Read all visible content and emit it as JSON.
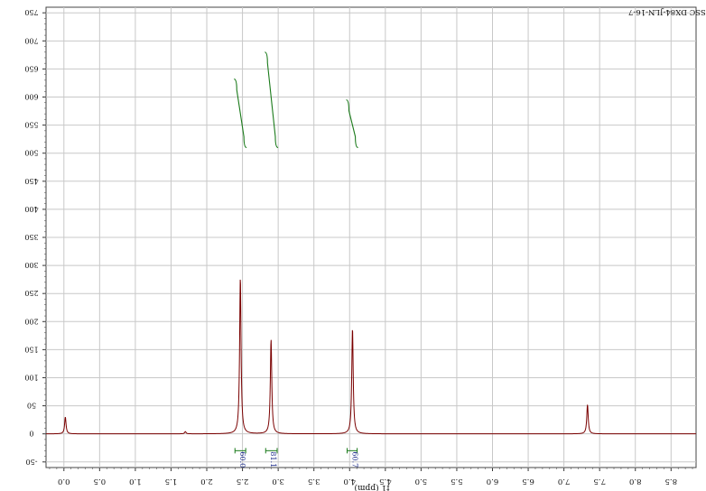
{
  "title": "SSC DX84-JLN-16-7",
  "chart_data": {
    "type": "line",
    "title": "SSC DX84-JLN-16-7",
    "xlabel": "f1 (ppm)",
    "ylabel": "",
    "x_reversed_display": true,
    "xlim": [
      -0.25,
      8.85
    ],
    "ylim": [
      -60,
      760
    ],
    "x_ticks": [
      "0.0",
      "0.5",
      "1.0",
      "1.5",
      "2.0",
      "2.5",
      "3.0",
      "3.5",
      "4.0",
      "4.5",
      "5.0",
      "5.5",
      "6.0",
      "6.5",
      "7.0",
      "7.5",
      "8.0",
      "8.5"
    ],
    "x_tick_values": [
      0.0,
      0.5,
      1.0,
      1.5,
      2.0,
      2.5,
      3.0,
      3.5,
      4.0,
      4.5,
      5.0,
      5.5,
      6.0,
      6.5,
      7.0,
      7.5,
      8.0,
      8.5
    ],
    "y_ticks": [
      "750",
      "700",
      "650",
      "600",
      "550",
      "500",
      "450",
      "400",
      "350",
      "300",
      "250",
      "200",
      "150",
      "100",
      "50",
      "0",
      "-50"
    ],
    "y_tick_values": [
      750,
      700,
      650,
      600,
      550,
      500,
      450,
      400,
      350,
      300,
      250,
      200,
      150,
      100,
      50,
      0,
      -50
    ],
    "grid": true,
    "line_color": "#7a0000",
    "integral_color": "#1a7a1a",
    "integral_label_color": "#1a2a8a",
    "peaks": [
      {
        "x": 0.02,
        "height": 30
      },
      {
        "x": 1.7,
        "height": 4
      },
      {
        "x": 2.47,
        "height": 278
      },
      {
        "x": 2.9,
        "height": 168
      },
      {
        "x": 4.04,
        "height": 188
      },
      {
        "x": 7.33,
        "height": 52
      }
    ],
    "integrals": [
      {
        "x": 2.47,
        "from": 2.42,
        "to": 2.52,
        "label": "60.0",
        "y_start": 510,
        "y_end": 632
      },
      {
        "x": 2.9,
        "from": 2.85,
        "to": 2.96,
        "label": "81.1",
        "y_start": 510,
        "y_end": 680
      },
      {
        "x": 4.04,
        "from": 3.99,
        "to": 4.08,
        "label": "60.7",
        "y_start": 510,
        "y_end": 595
      }
    ]
  }
}
